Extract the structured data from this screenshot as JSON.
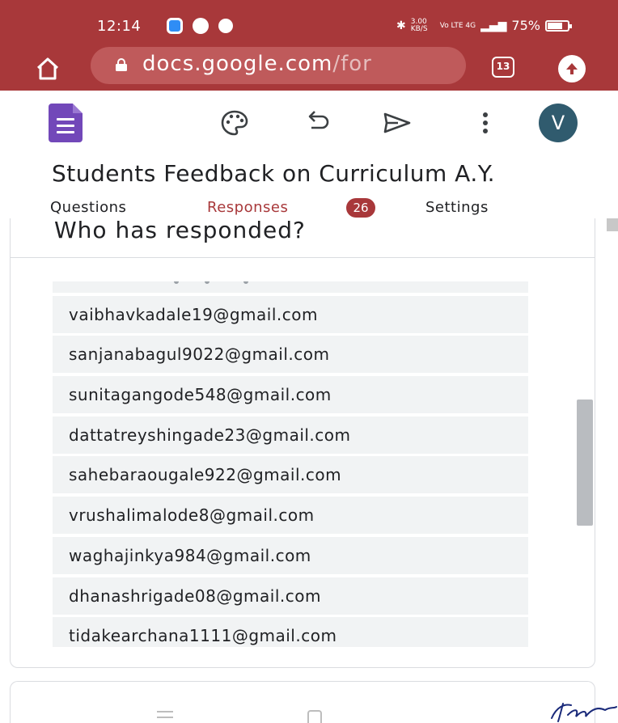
{
  "status_bar": {
    "time": "12:14",
    "network_speed": "3.00 KB/S",
    "network_type": "Vo LTE 4G",
    "battery": "75%"
  },
  "browser": {
    "url_host": "docs.google.com",
    "url_path": "/for",
    "tab_count": "13"
  },
  "forms": {
    "title": "Students Feedback on Curriculum A.Y.",
    "avatar_initial": "V",
    "tabs": {
      "questions": "Questions",
      "responses": "Responses",
      "responses_count": "26",
      "settings": "Settings"
    }
  },
  "respondents": {
    "heading": "Who has responded?",
    "emails": [
      "vaibhavkadale19@gmail.com",
      "sanjanabagul9022@gmail.com",
      "sunitagangode548@gmail.com",
      "dattatreyshingade23@gmail.com",
      "sahebaraougale922@gmail.com",
      "vrushalimalode8@gmail.com",
      "waghajinkya984@gmail.com",
      "dhanashrigade08@gmail.com",
      "tidakearchana1111@gmail.com"
    ]
  },
  "colors": {
    "accent": "#a8383a",
    "forms_purple": "#7248b9",
    "avatar": "#305b6e",
    "row_bg": "#f1f3f4"
  },
  "icons": {
    "home": "home-icon",
    "lock": "lock-icon",
    "palette": "palette-icon",
    "undo": "undo-icon",
    "send": "send-icon",
    "more": "more-vert-icon",
    "upload": "upload-icon"
  }
}
